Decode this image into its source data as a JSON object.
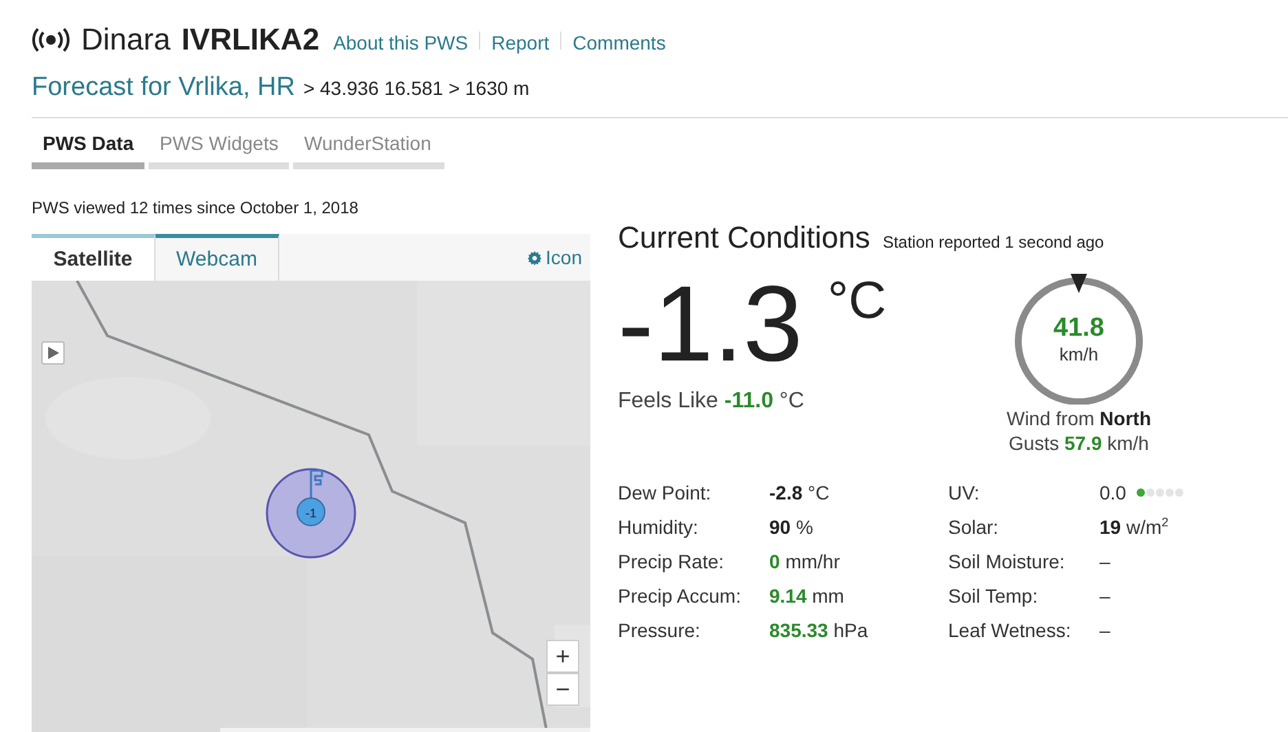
{
  "station": {
    "name": "Dinara",
    "id": "IVRLIKA2",
    "links": [
      "About this PWS",
      "Report",
      "Comments"
    ]
  },
  "forecast": {
    "link": "Forecast for Vrlika, HR",
    "coords": "> 43.936 16.581 > 1630 m"
  },
  "tabs": [
    {
      "label": "PWS Data",
      "selected": true
    },
    {
      "label": "PWS Widgets",
      "selected": false
    },
    {
      "label": "WunderStation",
      "selected": false
    }
  ],
  "views": "PWS viewed 12 times since October 1, 2018",
  "map": {
    "tabs": [
      {
        "label": "Satellite",
        "selected": true
      },
      {
        "label": "Webcam",
        "selected": false
      }
    ],
    "settings": "Icon",
    "marker_label": "-1",
    "zoom_in": "+",
    "zoom_out": "−"
  },
  "current": {
    "title": "Current Conditions",
    "reported": "Station reported 1 second ago",
    "temperature": "-1.3",
    "temp_unit": "°C",
    "feels_like_label": "Feels Like",
    "feels_like": "-11.0",
    "feels_like_unit": "°C",
    "wind": {
      "speed": "41.8",
      "unit": "km/h",
      "from_label": "Wind from",
      "direction": "North",
      "gusts_label": "Gusts",
      "gusts": "57.9",
      "gusts_unit": "km/h"
    }
  },
  "details_left": [
    {
      "label": "Dew Point:",
      "value": "-2.8",
      "unit": "°C",
      "kind": "bold"
    },
    {
      "label": "Humidity:",
      "value": "90",
      "unit": "%",
      "kind": "bold"
    },
    {
      "label": "Precip Rate:",
      "value": "0",
      "unit": "mm/hr",
      "kind": "green"
    },
    {
      "label": "Precip Accum:",
      "value": "9.14",
      "unit": "mm",
      "kind": "green"
    },
    {
      "label": "Pressure:",
      "value": "835.33",
      "unit": "hPa",
      "kind": "green"
    }
  ],
  "details_right": [
    {
      "label": "UV:",
      "value": "0.0",
      "kind": "plain",
      "stars": 1
    },
    {
      "label": "Solar:",
      "value": "19",
      "unit": "w/m$^{2}$",
      "kind": "bold"
    },
    {
      "label": "Soil Moisture:",
      "value": "–",
      "kind": "plain"
    },
    {
      "label": "Soil Temp:",
      "value": "–",
      "kind": "plain"
    },
    {
      "label": "Leaf Wetness:",
      "value": "–",
      "kind": "plain"
    }
  ]
}
